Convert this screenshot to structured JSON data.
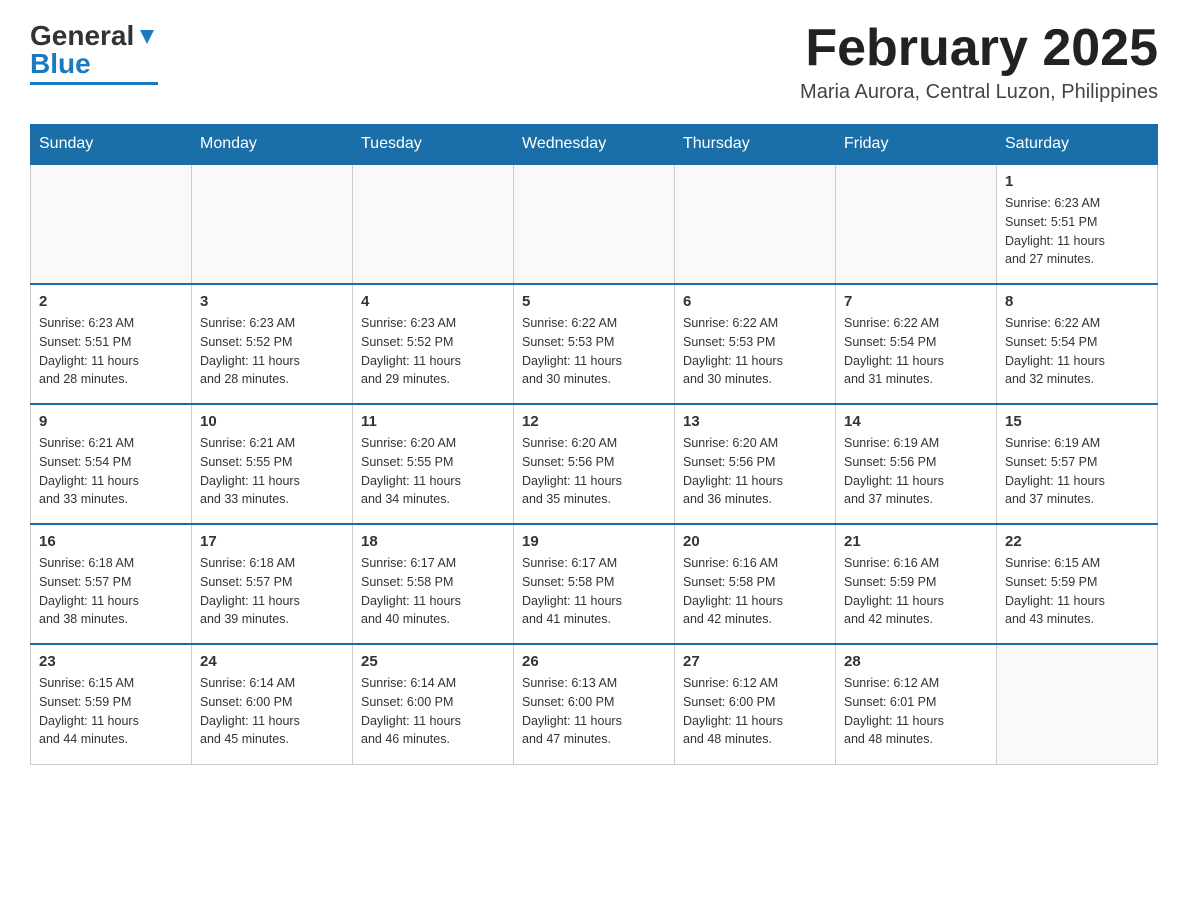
{
  "header": {
    "logo_general": "General",
    "logo_blue": "Blue",
    "month_title": "February 2025",
    "location": "Maria Aurora, Central Luzon, Philippines"
  },
  "days_of_week": [
    "Sunday",
    "Monday",
    "Tuesday",
    "Wednesday",
    "Thursday",
    "Friday",
    "Saturday"
  ],
  "weeks": [
    [
      {
        "day": "",
        "info": ""
      },
      {
        "day": "",
        "info": ""
      },
      {
        "day": "",
        "info": ""
      },
      {
        "day": "",
        "info": ""
      },
      {
        "day": "",
        "info": ""
      },
      {
        "day": "",
        "info": ""
      },
      {
        "day": "1",
        "info": "Sunrise: 6:23 AM\nSunset: 5:51 PM\nDaylight: 11 hours\nand 27 minutes."
      }
    ],
    [
      {
        "day": "2",
        "info": "Sunrise: 6:23 AM\nSunset: 5:51 PM\nDaylight: 11 hours\nand 28 minutes."
      },
      {
        "day": "3",
        "info": "Sunrise: 6:23 AM\nSunset: 5:52 PM\nDaylight: 11 hours\nand 28 minutes."
      },
      {
        "day": "4",
        "info": "Sunrise: 6:23 AM\nSunset: 5:52 PM\nDaylight: 11 hours\nand 29 minutes."
      },
      {
        "day": "5",
        "info": "Sunrise: 6:22 AM\nSunset: 5:53 PM\nDaylight: 11 hours\nand 30 minutes."
      },
      {
        "day": "6",
        "info": "Sunrise: 6:22 AM\nSunset: 5:53 PM\nDaylight: 11 hours\nand 30 minutes."
      },
      {
        "day": "7",
        "info": "Sunrise: 6:22 AM\nSunset: 5:54 PM\nDaylight: 11 hours\nand 31 minutes."
      },
      {
        "day": "8",
        "info": "Sunrise: 6:22 AM\nSunset: 5:54 PM\nDaylight: 11 hours\nand 32 minutes."
      }
    ],
    [
      {
        "day": "9",
        "info": "Sunrise: 6:21 AM\nSunset: 5:54 PM\nDaylight: 11 hours\nand 33 minutes."
      },
      {
        "day": "10",
        "info": "Sunrise: 6:21 AM\nSunset: 5:55 PM\nDaylight: 11 hours\nand 33 minutes."
      },
      {
        "day": "11",
        "info": "Sunrise: 6:20 AM\nSunset: 5:55 PM\nDaylight: 11 hours\nand 34 minutes."
      },
      {
        "day": "12",
        "info": "Sunrise: 6:20 AM\nSunset: 5:56 PM\nDaylight: 11 hours\nand 35 minutes."
      },
      {
        "day": "13",
        "info": "Sunrise: 6:20 AM\nSunset: 5:56 PM\nDaylight: 11 hours\nand 36 minutes."
      },
      {
        "day": "14",
        "info": "Sunrise: 6:19 AM\nSunset: 5:56 PM\nDaylight: 11 hours\nand 37 minutes."
      },
      {
        "day": "15",
        "info": "Sunrise: 6:19 AM\nSunset: 5:57 PM\nDaylight: 11 hours\nand 37 minutes."
      }
    ],
    [
      {
        "day": "16",
        "info": "Sunrise: 6:18 AM\nSunset: 5:57 PM\nDaylight: 11 hours\nand 38 minutes."
      },
      {
        "day": "17",
        "info": "Sunrise: 6:18 AM\nSunset: 5:57 PM\nDaylight: 11 hours\nand 39 minutes."
      },
      {
        "day": "18",
        "info": "Sunrise: 6:17 AM\nSunset: 5:58 PM\nDaylight: 11 hours\nand 40 minutes."
      },
      {
        "day": "19",
        "info": "Sunrise: 6:17 AM\nSunset: 5:58 PM\nDaylight: 11 hours\nand 41 minutes."
      },
      {
        "day": "20",
        "info": "Sunrise: 6:16 AM\nSunset: 5:58 PM\nDaylight: 11 hours\nand 42 minutes."
      },
      {
        "day": "21",
        "info": "Sunrise: 6:16 AM\nSunset: 5:59 PM\nDaylight: 11 hours\nand 42 minutes."
      },
      {
        "day": "22",
        "info": "Sunrise: 6:15 AM\nSunset: 5:59 PM\nDaylight: 11 hours\nand 43 minutes."
      }
    ],
    [
      {
        "day": "23",
        "info": "Sunrise: 6:15 AM\nSunset: 5:59 PM\nDaylight: 11 hours\nand 44 minutes."
      },
      {
        "day": "24",
        "info": "Sunrise: 6:14 AM\nSunset: 6:00 PM\nDaylight: 11 hours\nand 45 minutes."
      },
      {
        "day": "25",
        "info": "Sunrise: 6:14 AM\nSunset: 6:00 PM\nDaylight: 11 hours\nand 46 minutes."
      },
      {
        "day": "26",
        "info": "Sunrise: 6:13 AM\nSunset: 6:00 PM\nDaylight: 11 hours\nand 47 minutes."
      },
      {
        "day": "27",
        "info": "Sunrise: 6:12 AM\nSunset: 6:00 PM\nDaylight: 11 hours\nand 48 minutes."
      },
      {
        "day": "28",
        "info": "Sunrise: 6:12 AM\nSunset: 6:01 PM\nDaylight: 11 hours\nand 48 minutes."
      },
      {
        "day": "",
        "info": ""
      }
    ]
  ]
}
